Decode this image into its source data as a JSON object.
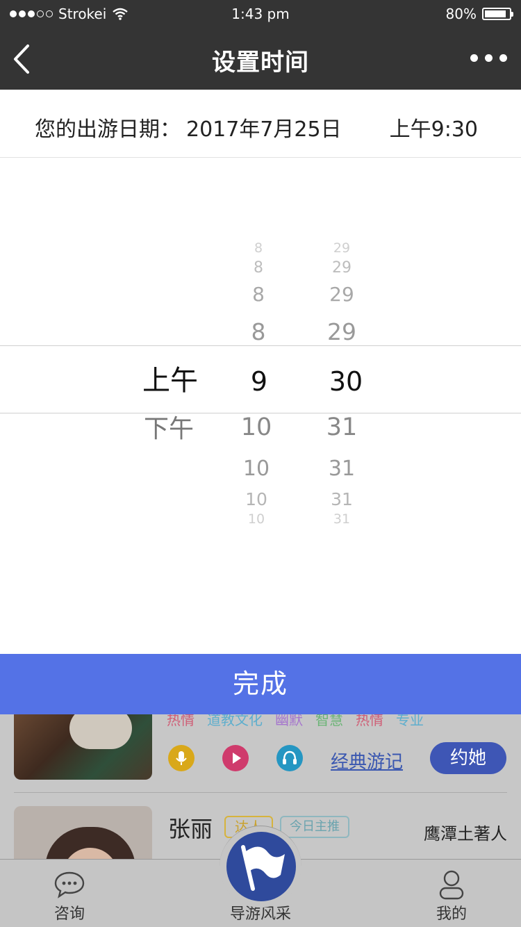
{
  "status": {
    "carrier": "Strokei",
    "time": "1:43 pm",
    "battery": "80%",
    "battery_level": 0.8,
    "signal_bars": 3
  },
  "nav": {
    "title": "设置时间"
  },
  "selection": {
    "label": "您的出游日期：",
    "date": "2017年7月25日",
    "time": "上午9:30"
  },
  "picker": {
    "period": {
      "selected": "上午",
      "after": [
        "下午"
      ]
    },
    "hour": {
      "before": [
        "8",
        "8",
        "8",
        "8"
      ],
      "selected": "9",
      "after": [
        "10",
        "10",
        "10",
        "10"
      ]
    },
    "minute": {
      "before": [
        "29",
        "29",
        "29",
        "29"
      ],
      "selected": "30",
      "after": [
        "31",
        "31",
        "31",
        "31"
      ]
    }
  },
  "done_button": "完成",
  "background_list": {
    "tags": [
      {
        "text": "热情",
        "color": "#d23a5a"
      },
      {
        "text": "道教文化",
        "color": "#3aa6d0"
      },
      {
        "text": "幽默",
        "color": "#9a5ad0"
      },
      {
        "text": "智慧",
        "color": "#4cae5a"
      },
      {
        "text": "热情",
        "color": "#d23a5a"
      },
      {
        "text": "专业",
        "color": "#3aa6d0"
      }
    ],
    "link": "经典游记",
    "book_button": "约她",
    "guide2": {
      "name": "张丽",
      "badge1": "达人",
      "badge2": "今日主推",
      "desc": "鹰潭土著人"
    }
  },
  "tabbar": {
    "consult": "咨询",
    "guides": "导游风采",
    "mine": "我的"
  }
}
